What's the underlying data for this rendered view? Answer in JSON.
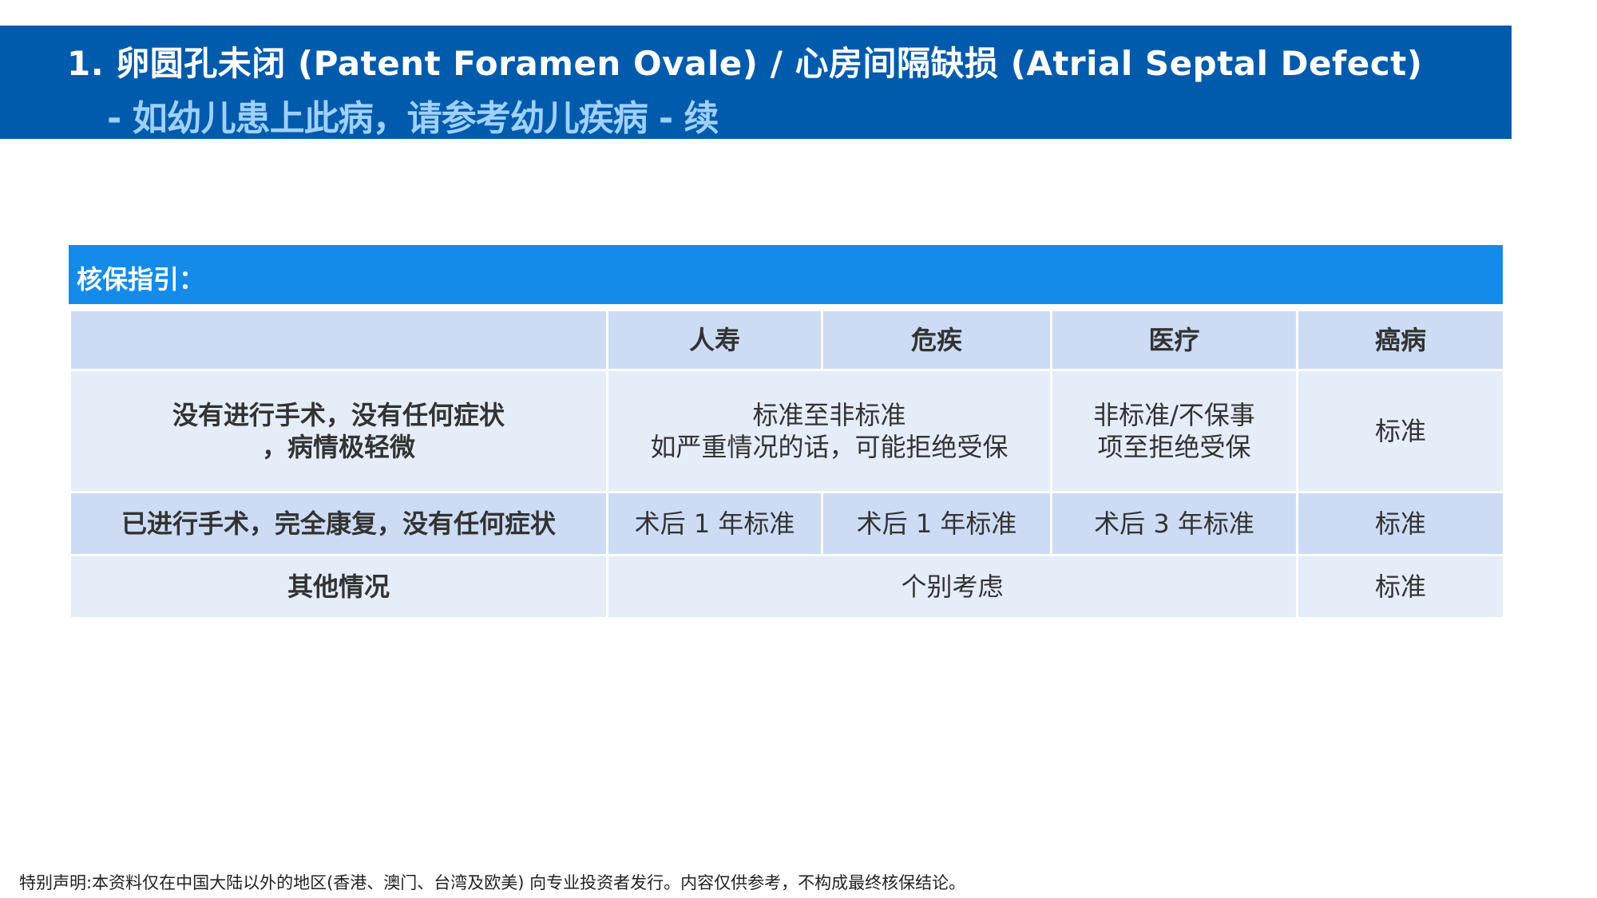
{
  "slide": {
    "title_line1": "1. 卵圆孔未闭 (Patent Foramen Ovale) / 心房间隔缺损 (Atrial Septal Defect)",
    "title_line2": "- 如幼儿患上此病，请参考幼儿疾病 - 续"
  },
  "guide": {
    "label": "核保指引："
  },
  "table": {
    "headers": [
      "",
      "人寿",
      "危疾",
      "医疗",
      "癌病"
    ],
    "rows": [
      {
        "label": "没有进行手术，没有任何症状\n，病情极轻微",
        "life_critical": "标准至非标准\n如严重情况的话，可能拒绝受保",
        "medical": "非标准/不保事\n项至拒绝受保",
        "cancer": "标准"
      },
      {
        "label": "已进行手术，完全康复，没有任何症状",
        "life": "术后 1 年标准",
        "critical": "术后 1 年标准",
        "medical": "术后 3 年标准",
        "cancer": "标准"
      },
      {
        "label": "其他情况",
        "life_critical_medical": "个别考虑",
        "cancer": "标准"
      }
    ]
  },
  "footer": {
    "disclaimer": "特别声明:本资料仅在中国大陆以外的地区(香港、澳门、台湾及欧美) 向专业投资者发行。内容仅供参考，不构成最终核保结论。"
  },
  "colors": {
    "header_bar": "#005bac",
    "title_white": "#ffffff",
    "subtitle_light_blue": "#9fd0ff",
    "guide_bar": "#148be8",
    "cell_dark": "#cddcf4",
    "cell_light": "#e5edf8"
  }
}
